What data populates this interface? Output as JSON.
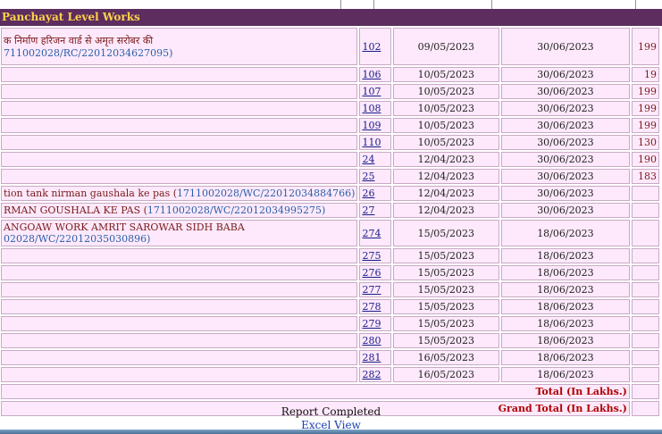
{
  "section_title": "Panchayat Level Works",
  "rows": [
    {
      "name": "क निर्माण हरिजन वार्ड से अमृत सरोबर की",
      "code": "711002028/RC/22012034627095)",
      "no": "102",
      "start": "09/05/2023",
      "end": "30/06/2023",
      "amount": "199"
    },
    {
      "name": "",
      "code": "",
      "no": "106",
      "start": "10/05/2023",
      "end": "30/06/2023",
      "amount": "19"
    },
    {
      "name": "",
      "code": "",
      "no": "107",
      "start": "10/05/2023",
      "end": "30/06/2023",
      "amount": "199"
    },
    {
      "name": "",
      "code": "",
      "no": "108",
      "start": "10/05/2023",
      "end": "30/06/2023",
      "amount": "199"
    },
    {
      "name": "",
      "code": "",
      "no": "109",
      "start": "10/05/2023",
      "end": "30/06/2023",
      "amount": "199"
    },
    {
      "name": "",
      "code": "",
      "no": "110",
      "start": "10/05/2023",
      "end": "30/06/2023",
      "amount": "130"
    },
    {
      "name": "",
      "code": "",
      "no": "24",
      "start": "12/04/2023",
      "end": "30/06/2023",
      "amount": "190"
    },
    {
      "name": "",
      "code": "",
      "no": "25",
      "start": "12/04/2023",
      "end": "30/06/2023",
      "amount": "183"
    },
    {
      "name": "tion tank nirman gaushala ke pas (",
      "code": "1711002028/WC/22012034884766)",
      "no": "26",
      "start": "12/04/2023",
      "end": "30/06/2023",
      "amount": ""
    },
    {
      "name": "RMAN GOUSHALA KE PAS (",
      "code": "1711002028/WC/22012034995275)",
      "no": "27",
      "start": "12/04/2023",
      "end": "30/06/2023",
      "amount": ""
    },
    {
      "name": "ANGOAW WORK AMRIT SAROWAR SIDH BABA",
      "code": "02028/WC/22012035030896)",
      "no": "274",
      "start": "15/05/2023",
      "end": "18/06/2023",
      "amount": ""
    },
    {
      "name": "",
      "code": "",
      "no": "275",
      "start": "15/05/2023",
      "end": "18/06/2023",
      "amount": ""
    },
    {
      "name": "",
      "code": "",
      "no": "276",
      "start": "15/05/2023",
      "end": "18/06/2023",
      "amount": ""
    },
    {
      "name": "",
      "code": "",
      "no": "277",
      "start": "15/05/2023",
      "end": "18/06/2023",
      "amount": ""
    },
    {
      "name": "",
      "code": "",
      "no": "278",
      "start": "15/05/2023",
      "end": "18/06/2023",
      "amount": ""
    },
    {
      "name": "",
      "code": "",
      "no": "279",
      "start": "15/05/2023",
      "end": "18/06/2023",
      "amount": ""
    },
    {
      "name": "",
      "code": "",
      "no": "280",
      "start": "15/05/2023",
      "end": "18/06/2023",
      "amount": ""
    },
    {
      "name": "",
      "code": "",
      "no": "281",
      "start": "16/05/2023",
      "end": "18/06/2023",
      "amount": ""
    },
    {
      "name": "",
      "code": "",
      "no": "282",
      "start": "16/05/2023",
      "end": "18/06/2023",
      "amount": ""
    }
  ],
  "totals": {
    "total_label": "Total (In Lakhs.)",
    "grand_total_label": "Grand Total (In Lakhs.)"
  },
  "footer": {
    "status": "Report Completed",
    "excel_link": "Excel View"
  }
}
